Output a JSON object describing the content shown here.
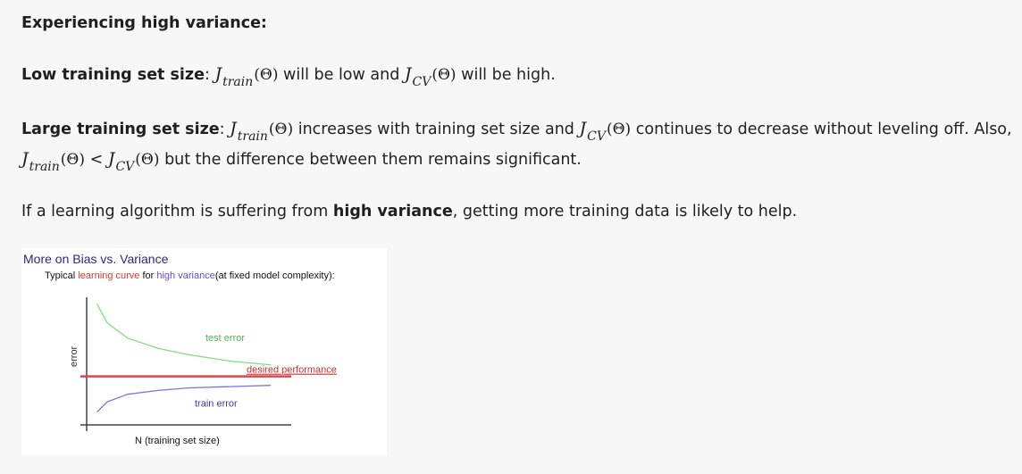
{
  "heading": "Experiencing high variance:",
  "low": {
    "label": "Low training set size",
    "sep": ":",
    "j1": "J",
    "j1_sub": "train",
    "j1_arg": "(Θ)",
    "mid": "will be low and",
    "j2": "J",
    "j2_sub": "CV",
    "j2_arg": "(Θ)",
    "end": "will be high."
  },
  "large": {
    "label": "Large training set size",
    "sep": ":",
    "j1": "J",
    "j1_sub": "train",
    "j1_arg": "(Θ)",
    "mid": "increases with training set size and",
    "j2": "J",
    "j2_sub": "CV",
    "j2_arg": "(Θ)",
    "end": "continues to decrease without leveling off. Also,",
    "line2_j1": "J",
    "line2_j1_sub": "train",
    "line2_j1_arg": "(Θ)",
    "line2_lt": "<",
    "line2_j2": "J",
    "line2_j2_sub": "CV",
    "line2_j2_arg": "(Θ)",
    "line2_end": "but the difference between them remains significant."
  },
  "conclusion": {
    "pre": "If a learning algorithm is suffering from",
    "bold": "high variance",
    "post": ", getting more training data is likely to help."
  },
  "figure": {
    "title": "More on Bias vs. Variance",
    "subtitle_pre": "Typical",
    "subtitle_lc": "learning curve",
    "subtitle_mid": "for",
    "subtitle_hv": "high variance",
    "subtitle_post": "(at fixed model complexity):"
  },
  "chart_data": {
    "type": "line",
    "xlabel": "N (training set size)",
    "ylabel": "error",
    "series": [
      {
        "name": "test error",
        "color": "#7ee07e",
        "x": [
          0.05,
          0.1,
          0.2,
          0.35,
          0.5,
          0.7,
          0.9
        ],
        "y": [
          0.95,
          0.8,
          0.68,
          0.6,
          0.55,
          0.5,
          0.47
        ]
      },
      {
        "name": "train error",
        "color": "#7a74e0",
        "x": [
          0.05,
          0.1,
          0.2,
          0.35,
          0.5,
          0.7,
          0.9
        ],
        "y": [
          0.1,
          0.18,
          0.24,
          0.27,
          0.29,
          0.3,
          0.31
        ]
      }
    ],
    "reference": {
      "name": "desired performance",
      "y": 0.38,
      "color": "#e8404a"
    }
  }
}
